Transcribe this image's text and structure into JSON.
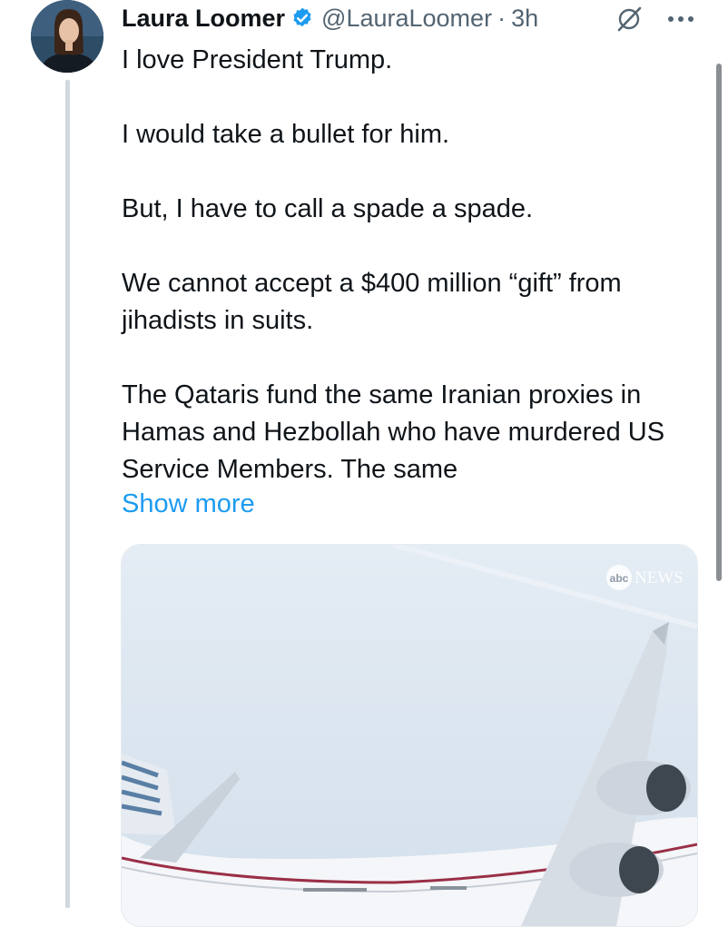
{
  "author": {
    "name": "Laura Loomer",
    "handle": "@LauraLoomer",
    "separator": "·",
    "time": "3h"
  },
  "icons": {
    "verified": "verified-badge-icon",
    "grok": "grok-icon",
    "more": "more-options-icon"
  },
  "tweet": {
    "paragraphs": [
      "I love President Trump.",
      "I would take a bullet for him.",
      "But, I have to call a spade a spade.",
      "We cannot accept a $400 million “gift” from jihadists in suits.",
      "The Qataris fund the same Iranian proxies in Hamas and Hezbollah who have murdered US Service Members. The same"
    ],
    "show_more": "Show more"
  },
  "media": {
    "watermark_logo": "abc",
    "watermark_text": "NEWS"
  },
  "colors": {
    "link": "#1d9bf0",
    "verified": "#1d9bf0",
    "secondary_text": "#536471",
    "sky": "#dfe8f1"
  }
}
